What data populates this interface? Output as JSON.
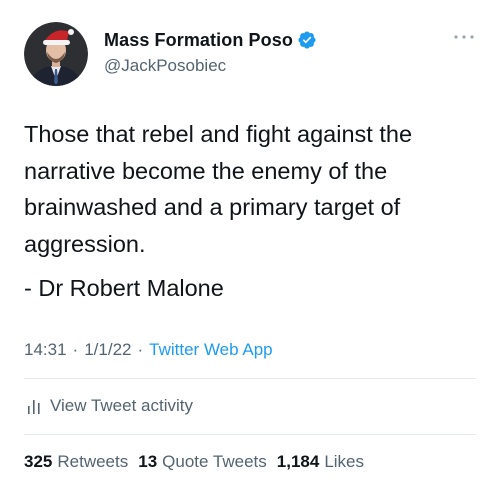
{
  "tweet": {
    "author": {
      "display_name": "Mass Formation Poso",
      "handle": "@JackPosobiec",
      "verified_icon": "verified-badge-icon",
      "avatar_icon": "user-avatar"
    },
    "more_icon": "more-dots-icon",
    "text": "Those that rebel and fight against the narrative become the enemy of the brainwashed and a primary target of aggression.",
    "attribution": "- Dr Robert Malone",
    "meta": {
      "time": "14:31",
      "separator": "·",
      "date": "1/1/22",
      "source": "Twitter Web App"
    },
    "activity": {
      "label": "View Tweet activity",
      "icon": "bar-chart-icon"
    },
    "stats": {
      "retweets_count": "325",
      "retweets_label": "Retweets",
      "quotes_count": "13",
      "quotes_label": "Quote Tweets",
      "likes_count": "1,184",
      "likes_label": "Likes"
    }
  },
  "colors": {
    "text_primary": "#0f1419",
    "text_secondary": "#536471",
    "link": "#1d9bf0",
    "verified": "#1d9bf0",
    "divider": "#e6e9ec"
  }
}
